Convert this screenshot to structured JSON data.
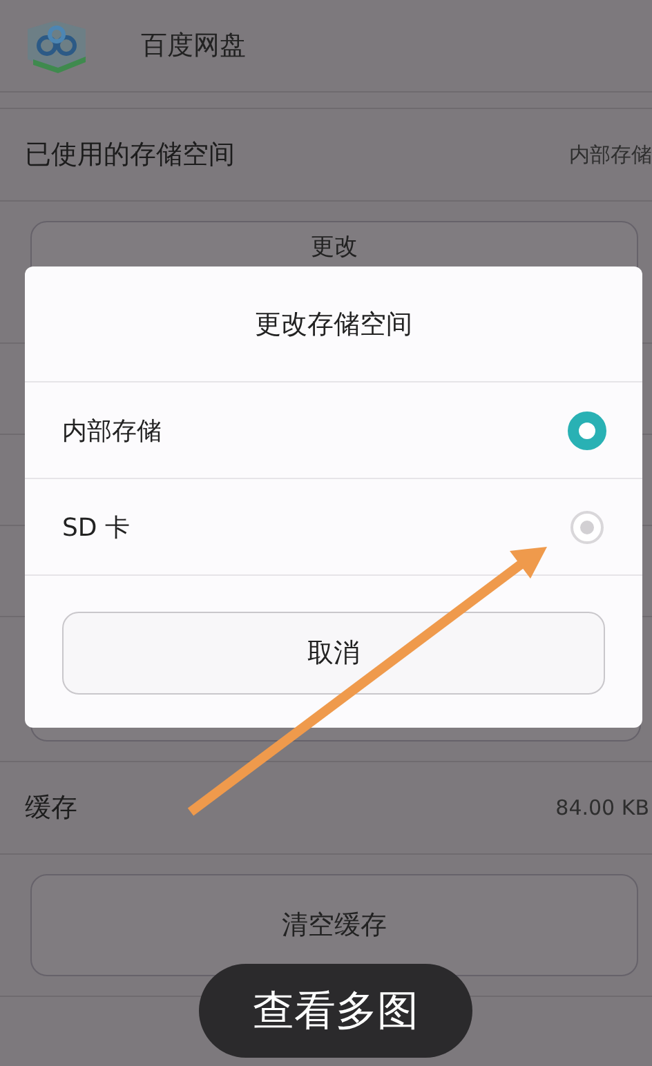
{
  "app_bar": {
    "title": "百度网盘"
  },
  "storage": {
    "label": "已使用的存储空间",
    "value": "内部存储",
    "button": "更改"
  },
  "covered_rows": [
    {},
    {},
    {}
  ],
  "cache": {
    "label": "缓存",
    "value": "84.00 KB",
    "button": "清空缓存"
  },
  "dialog": {
    "title": "更改存储空间",
    "options": [
      {
        "label": "内部存储",
        "selected": true
      },
      {
        "label": "SD 卡",
        "selected": false
      }
    ],
    "cancel": "取消"
  },
  "overlay_button": "查看多图"
}
